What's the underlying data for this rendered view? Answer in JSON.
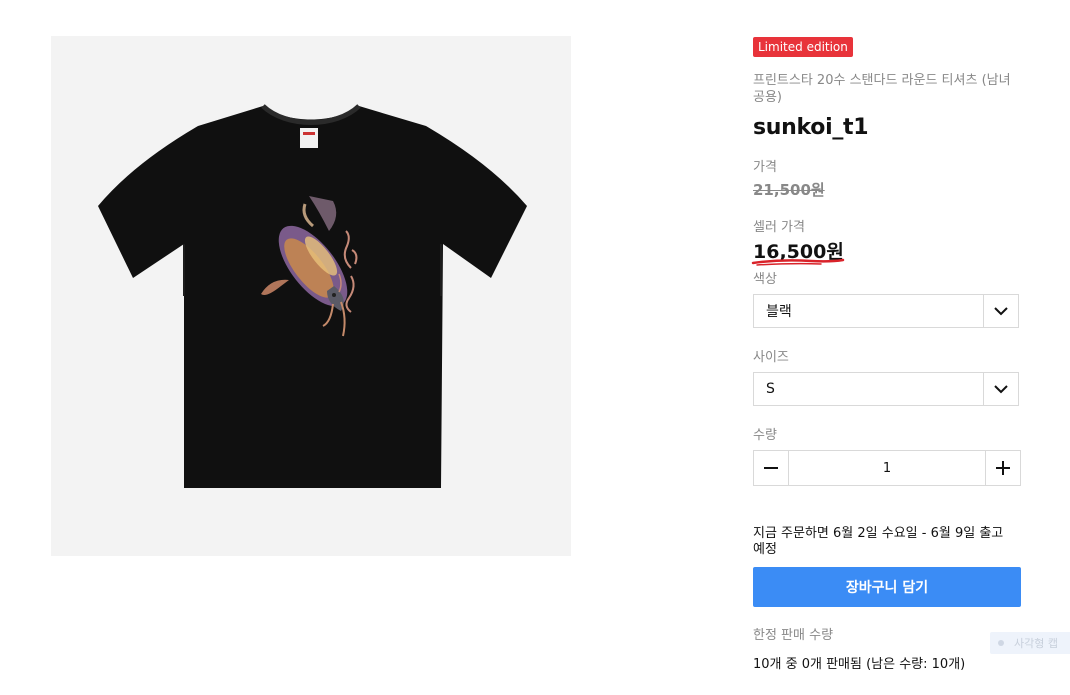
{
  "product": {
    "badge": "Limited edition",
    "subtitle": "프린트스타 20수 스탠다드 라운드 티셔츠 (남녀공용)",
    "title": "sunkoi_t1",
    "image_alt": "black t-shirt with koi print"
  },
  "pricing": {
    "price_label": "가격",
    "original_price": "21,500원",
    "seller_label": "셀러 가격",
    "seller_price": "16,500원"
  },
  "options": {
    "color_label": "색상",
    "color_value": "블랙",
    "size_label": "사이즈",
    "size_value": "S",
    "qty_label": "수량",
    "qty_value": "1"
  },
  "shipping": {
    "text": "지금 주문하면 6월 2일 수요일 - 6월 9일 출고 예정"
  },
  "cart": {
    "button_label": "장바구니 담기"
  },
  "limit": {
    "label": "한정 판매 수량",
    "text": "10개 중 0개 판매됨 (남은 수량: 10개)"
  },
  "widget": {
    "text": "사각형 캡"
  },
  "colors": {
    "badge_bg": "#e8333a",
    "accent": "#3b8cf5",
    "underline": "#d9232a"
  },
  "icons": [
    "chevron-down-icon",
    "minus-icon",
    "plus-icon"
  ]
}
